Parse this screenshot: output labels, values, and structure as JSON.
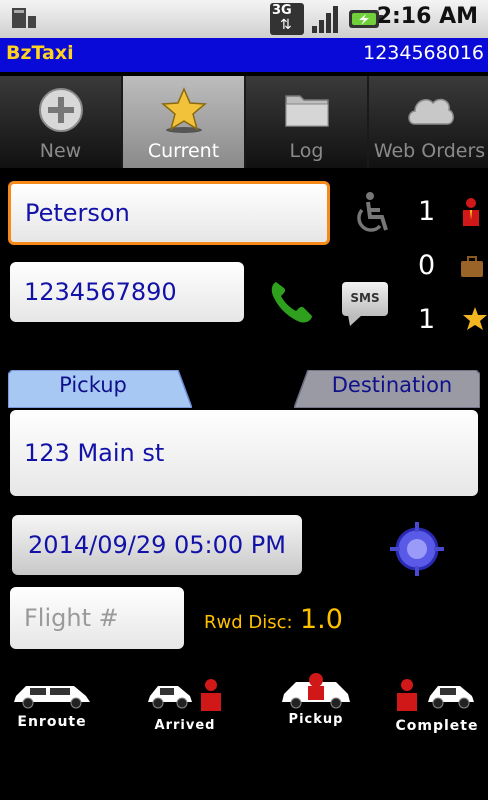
{
  "status": {
    "network": "3G",
    "time": "2:16 AM"
  },
  "app": {
    "title": "BzTaxi",
    "phone": "1234568016"
  },
  "tabs": [
    {
      "label": "New",
      "icon": "plus-circle-icon",
      "selected": false
    },
    {
      "label": "Current",
      "icon": "star-icon",
      "selected": true
    },
    {
      "label": "Log",
      "icon": "folder-icon",
      "selected": false
    },
    {
      "label": "Web Orders",
      "icon": "cloud-icon",
      "selected": false
    }
  ],
  "form": {
    "name": "Peterson",
    "phone": "1234567890",
    "sms_label": "SMS",
    "wheelchair_count": "1",
    "luggage_count": "0",
    "rating_count": "1",
    "pickup_tab": "Pickup",
    "destination_tab": "Destination",
    "address": "123 Main st",
    "datetime": "2014/09/29 05:00 PM",
    "flight_placeholder": "Flight #",
    "rwd_label": "Rwd Disc:",
    "rwd_value": "1.0"
  },
  "actions": [
    {
      "label": "Enroute"
    },
    {
      "label": "Arrived"
    },
    {
      "label": "Pickup"
    },
    {
      "label": "Complete"
    }
  ],
  "colors": {
    "title_bar": "#0a0ad8",
    "app_title": "#ffd21f",
    "focus_border": "#f58a1a",
    "field_text": "#1212a8",
    "rwd": "#ffc000"
  }
}
